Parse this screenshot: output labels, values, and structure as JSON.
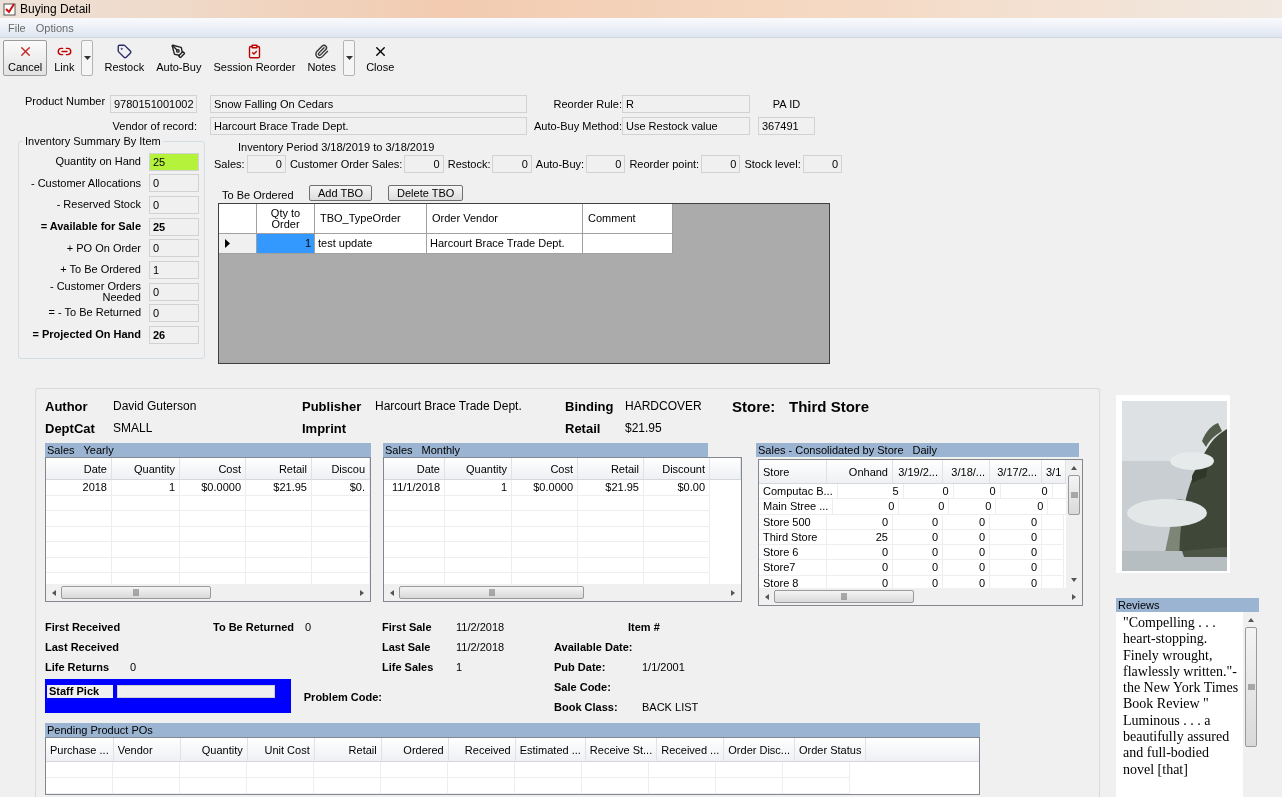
{
  "window": {
    "title": "Buying Detail"
  },
  "menu": [
    "File",
    "Options"
  ],
  "toolbar": [
    {
      "label": "Cancel",
      "dropdown": false,
      "hot": true
    },
    {
      "label": "Link",
      "dropdown": true,
      "hot": false
    },
    {
      "label": "Restock",
      "dropdown": false,
      "hot": false
    },
    {
      "label": "Auto-Buy",
      "dropdown": false,
      "hot": false
    },
    {
      "label": "Session Reorder",
      "dropdown": false,
      "hot": false
    },
    {
      "label": "Notes",
      "dropdown": true,
      "hot": false
    },
    {
      "label": "Close",
      "dropdown": false,
      "hot": false
    }
  ],
  "product": {
    "number_label": "Product Number",
    "number": "9780151001002",
    "title": "Snow Falling On Cedars",
    "vendor_label": "Vendor of record:",
    "vendor": "Harcourt Brace Trade Dept.",
    "reorder_rule_label": "Reorder Rule:",
    "reorder_rule": "R",
    "auto_buy_label": "Auto-Buy Method:",
    "auto_buy": "Use Restock value",
    "pa_id_label": "PA ID",
    "pa_id": "367491"
  },
  "inventory_summary": {
    "title": "Inventory Summary By Item",
    "rows": [
      {
        "label": "Quantity on Hand",
        "value": "25",
        "kind": "line",
        "highlighted": true
      },
      {
        "label": "- Customer Allocations",
        "value": "0",
        "kind": "line",
        "highlighted": false
      },
      {
        "label": "- Reserved Stock",
        "value": "0",
        "kind": "line",
        "highlighted": false
      },
      {
        "label": "= Available for Sale",
        "value": "25",
        "kind": "total",
        "highlighted": false
      },
      {
        "label": "+ PO On Order",
        "value": "0",
        "kind": "line",
        "highlighted": false
      },
      {
        "label": "+ To Be Ordered",
        "value": "1",
        "kind": "line",
        "highlighted": false
      },
      {
        "label": "- Customer Orders Needed",
        "value": "0",
        "kind": "line",
        "highlighted": false
      },
      {
        "label": "= - To Be Returned",
        "value": "0",
        "kind": "line",
        "highlighted": false
      },
      {
        "label": "= Projected On Hand",
        "value": "26",
        "kind": "total",
        "highlighted": false
      }
    ]
  },
  "inventory_period": "Inventory Period 3/18/2019 to 3/18/2019",
  "stats": [
    {
      "label": "Sales:",
      "value": "0"
    },
    {
      "label": "Customer Order Sales:",
      "value": "0"
    },
    {
      "label": "Restock:",
      "value": "0"
    },
    {
      "label": "Auto-Buy:",
      "value": "0"
    },
    {
      "label": "Reorder point:",
      "value": "0"
    },
    {
      "label": "Stock level:",
      "value": "0"
    }
  ],
  "to_be_ordered": {
    "label": "To Be Ordered",
    "buttons": [
      "Add TBO",
      "Delete TBO"
    ],
    "columns": [
      "Qty to Order",
      "TBO_TypeOrder",
      "Order Vendor",
      "Comment"
    ],
    "rows": [
      {
        "selected": true,
        "cells": [
          "1",
          "test update",
          "Harcourt Brace Trade Dept."
        ]
      }
    ]
  },
  "info": [
    {
      "label": "Author",
      "value": "David Guterson"
    },
    {
      "label": "Publisher",
      "value": "Harcourt Brace Trade Dept."
    },
    {
      "label": "Binding",
      "value": "HARDCOVER"
    },
    {
      "label": "DeptCat",
      "value": "SMALL"
    },
    {
      "label": "Imprint"
    },
    {
      "label": "Retail",
      "value": "$21.95"
    }
  ],
  "store": {
    "label": "Store:",
    "value": "Third Store"
  },
  "sales_yearly": {
    "title": "Sales",
    "period": "Yearly",
    "columns": [
      "Date",
      "Quantity",
      "Cost",
      "Retail",
      "Discou"
    ],
    "rows": [
      [
        "2018",
        "1",
        "$0.0000",
        "$21.95",
        "$0."
      ]
    ]
  },
  "sales_monthly": {
    "title": "Sales",
    "period": "Monthly",
    "columns": [
      "Date",
      "Quantity",
      "Cost",
      "Retail",
      "Discount"
    ],
    "rows": [
      [
        "11/1/2018",
        "1",
        "$0.0000",
        "$21.95",
        "$0.00"
      ]
    ]
  },
  "sales_by_store": {
    "title": "Sales - Consolidated by Store",
    "period": "Daily",
    "columns": [
      "Store",
      "Onhand",
      "3/19/2...",
      "3/18/...",
      "3/17/2...",
      "3/1"
    ],
    "rows": [
      [
        "Computac B...",
        "5",
        "0",
        "0",
        "0"
      ],
      [
        "Main Stree ...",
        "0",
        "0",
        "0",
        "0"
      ],
      [
        "Store 500",
        "0",
        "0",
        "0",
        "0"
      ],
      [
        "Third Store",
        "25",
        "0",
        "0",
        "0"
      ],
      [
        "Store 6",
        "0",
        "0",
        "0",
        "0"
      ],
      [
        "Store7",
        "0",
        "0",
        "0",
        "0"
      ],
      [
        "Store 8",
        "0",
        "0",
        "0",
        "0"
      ]
    ]
  },
  "receiving": [
    {
      "label": "First Received"
    },
    {
      "label": "Last Received"
    },
    {
      "label": "Life Returns",
      "value": "0"
    }
  ],
  "to_be_returned": {
    "label": "To Be Returned",
    "value": "0"
  },
  "staff_pick": {
    "label": "Staff Pick"
  },
  "problem_code": {
    "label": "Problem Code:"
  },
  "sales_dates": [
    {
      "label": "First Sale",
      "value": "11/2/2018"
    },
    {
      "label": "Last Sale",
      "value": "11/2/2018"
    },
    {
      "label": "Life Sales",
      "value": "1"
    }
  ],
  "item_info": [
    {
      "label": "Item #"
    },
    {
      "label": "Available Date:"
    },
    {
      "label": "Pub Date:",
      "value": "1/1/2001"
    },
    {
      "label": "Sale Code:"
    },
    {
      "label": "Book Class:",
      "value": "BACK LIST"
    }
  ],
  "pending_pos": {
    "title": "Pending Product POs",
    "columns": [
      "Purchase ...",
      "Vendor",
      "Quantity",
      "Unit Cost",
      "Retail",
      "Ordered",
      "Received",
      "Estimated ...",
      "Receive St...",
      "Received ...",
      "Order Disc...",
      "Order Status"
    ]
  },
  "cover": {
    "kind": "picture"
  },
  "reviews": {
    "title": "Reviews",
    "text": "\"Compelling . . . heart-stopping. Finely wrought, flawlessly written.\"-the New York Times Book Review \" Luminous . . . a beautifully assured and full-bodied novel [that]"
  }
}
